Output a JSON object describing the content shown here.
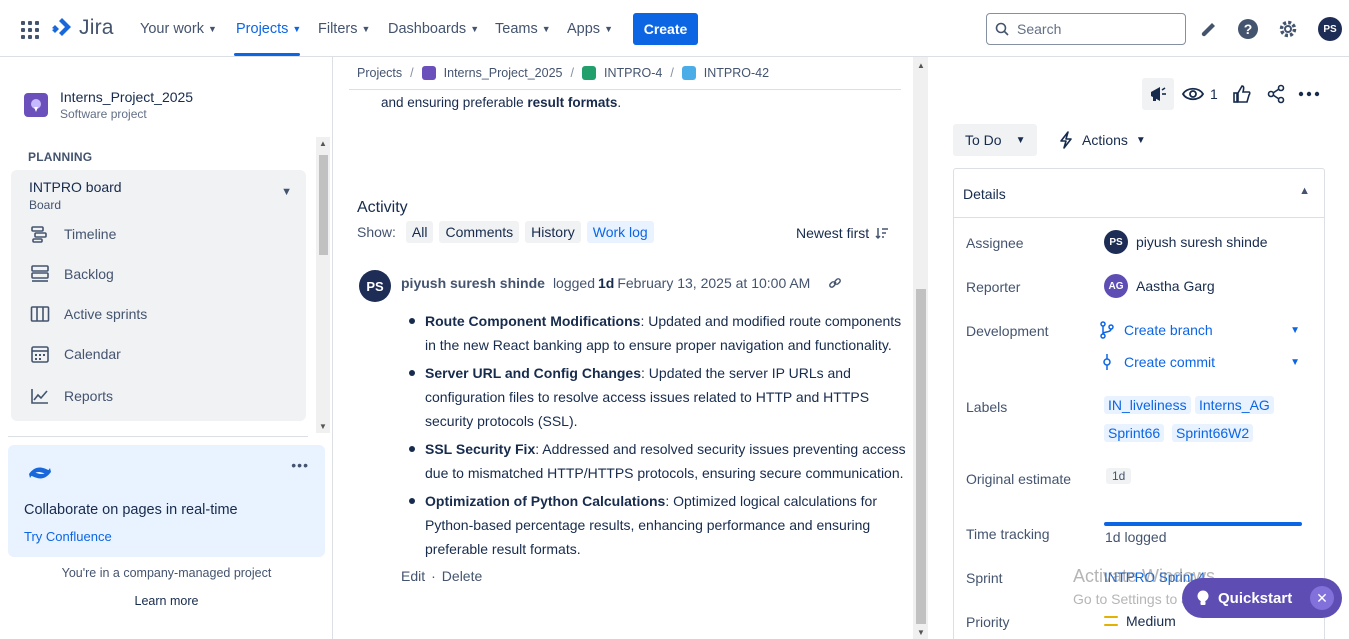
{
  "topnav": {
    "app_name": "Jira",
    "items": [
      {
        "label": "Your work"
      },
      {
        "label": "Projects"
      },
      {
        "label": "Filters"
      },
      {
        "label": "Dashboards"
      },
      {
        "label": "Teams"
      },
      {
        "label": "Apps"
      }
    ],
    "active_item": "Projects",
    "create_label": "Create",
    "search_placeholder": "Search",
    "avatar_initials": "PS",
    "accent_color": "#0c66e4"
  },
  "sidebar": {
    "project_name": "Interns_Project_2025",
    "project_type": "Software project",
    "section_title": "PLANNING",
    "board_title": "INTPRO board",
    "board_sub": "Board",
    "items": [
      {
        "label": "Timeline",
        "icon": "timeline-icon"
      },
      {
        "label": "Backlog",
        "icon": "backlog-icon"
      },
      {
        "label": "Active sprints",
        "icon": "board-icon"
      },
      {
        "label": "Calendar",
        "icon": "calendar-icon"
      },
      {
        "label": "Reports",
        "icon": "reports-icon"
      }
    ],
    "promo_title": "Collaborate on pages in real-time",
    "promo_link": "Try Confluence",
    "managed_text": "You're in a company-managed project",
    "learn_more": "Learn more"
  },
  "breadcrumb": {
    "items": [
      "Projects",
      "Interns_Project_2025",
      "INTPRO-4",
      "INTPRO-42"
    ]
  },
  "main": {
    "description_tail_prefix": "and ensuring preferable ",
    "description_tail_bold": "result formats",
    "description_tail_suffix": ".",
    "activity_title": "Activity",
    "show_label": "Show:",
    "filters": [
      "All",
      "Comments",
      "History",
      "Work log"
    ],
    "selected_filter": "Work log",
    "sort_label": "Newest first",
    "worklog": {
      "avatar_initials": "PS",
      "author": "piyush suresh shinde",
      "logged_label": "logged",
      "amount": "1d",
      "date": "February 13, 2025 at 10:00 AM",
      "bullets": [
        {
          "bold": "Route Component Modifications",
          "text": ": Updated and modified route components in the new React banking app to ensure proper navigation and functionality."
        },
        {
          "bold": "Server URL and Config Changes",
          "text": ": Updated the server IP URLs and configuration files to resolve access issues related to HTTP and HTTPS security protocols (SSL)."
        },
        {
          "bold": "SSL Security Fix",
          "text": ": Addressed and resolved security issues preventing access due to mismatched HTTP/HTTPS protocols, ensuring secure communication."
        },
        {
          "bold": "Optimization of Python Calculations",
          "text": ": Optimized logical calculations for Python-based percentage results, enhancing performance and ensuring preferable result formats."
        }
      ],
      "edit_label": "Edit",
      "separator": "·",
      "delete_label": "Delete"
    }
  },
  "right_panel": {
    "watch_count": "1",
    "status_label": "To Do",
    "actions_label": "Actions",
    "details_title": "Details",
    "fields": {
      "assignee_label": "Assignee",
      "assignee_initials": "PS",
      "assignee_name": "piyush suresh shinde",
      "reporter_label": "Reporter",
      "reporter_initials": "AG",
      "reporter_name": "Aastha Garg",
      "development_label": "Development",
      "create_branch": "Create branch",
      "create_commit": "Create commit",
      "labels_label": "Labels",
      "labels": [
        "IN_liveliness",
        "Interns_AG",
        "Sprint66",
        "Sprint66W2"
      ],
      "estimate_label": "Original estimate",
      "estimate_value": "1d",
      "time_tracking_label": "Time tracking",
      "time_logged": "1d logged",
      "time_tracking_progress": 1.0,
      "sprint_label": "Sprint",
      "sprint_value": "INTPRO Sprint 4",
      "priority_label": "Priority",
      "priority_value": "Medium"
    }
  },
  "overlay": {
    "watermark_title": "Activate Windows",
    "watermark_sub": "Go to Settings to activate Windows.",
    "quickstart_label": "Quickstart",
    "quickstart_color": "#5e4db2"
  }
}
